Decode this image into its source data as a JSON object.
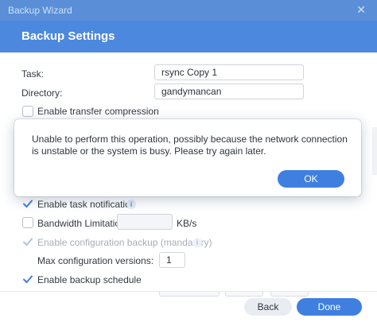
{
  "window": {
    "title": "Backup Wizard",
    "close_glyph": "✕"
  },
  "header": {
    "title": "Backup Settings"
  },
  "form": {
    "task_label": "Task:",
    "task_value": "rsync Copy 1",
    "directory_label": "Directory:",
    "directory_value": "gandymancan",
    "transfer_compression_label": "Enable transfer compression",
    "task_notification_label": "Enable task notification",
    "bandwidth_label": "Bandwidth Limitation",
    "bandwidth_value": "",
    "bandwidth_unit": "KB/s",
    "config_backup_label": "Enable configuration backup (mandatory)",
    "max_versions_label": "Max configuration versions:",
    "max_versions_value": "1",
    "backup_schedule_label": "Enable backup schedule"
  },
  "dialog": {
    "message": "Unable to perform this operation, possibly because the network connection is unstable or the system is busy. Please try again later.",
    "ok_label": "OK"
  },
  "footer": {
    "back_label": "Back",
    "done_label": "Done"
  },
  "icons": {
    "info": "i",
    "check": "check-icon"
  },
  "colors": {
    "accent": "#3f7fe0",
    "header": "#4c89de",
    "titlebar": "#5a8fd8"
  }
}
